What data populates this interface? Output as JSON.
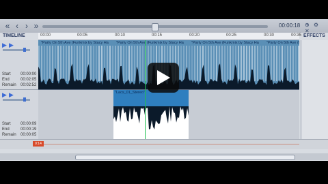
{
  "window": {
    "timecode": "00:00:18",
    "icons": "⊕ ⚙ ✕"
  },
  "panels": {
    "timeline_title": "TIMELINE",
    "effects_title": "EFFECTS"
  },
  "ruler": {
    "ticks": [
      "00:00",
      "00:05",
      "00:10",
      "00:15",
      "00:20",
      "00:25",
      "00:30",
      "00:35"
    ]
  },
  "track1": {
    "start_label": "Start",
    "start_value": "00:00:00",
    "end_label": "End",
    "end_value": "00:02:05",
    "remain_label": "Remain",
    "remain_value": "00:02:52",
    "clip_title": "\"Party On 5th Ave (Funkmix by Stacy Ha"
  },
  "track2": {
    "start_label": "Start",
    "start_value": "00:00:09",
    "end_label": "End",
    "end_value": "00:00:19",
    "remain_label": "Remain",
    "remain_value": "00:00:05",
    "clip_title": "\"Lacs_01_Stereo\""
  },
  "marker": {
    "label": "0:14"
  },
  "colors": {
    "track_wave": "#0b1a2a",
    "track_bg": "#5a8fb6",
    "playhead": "#20c050",
    "marker": "#d84a2a"
  }
}
